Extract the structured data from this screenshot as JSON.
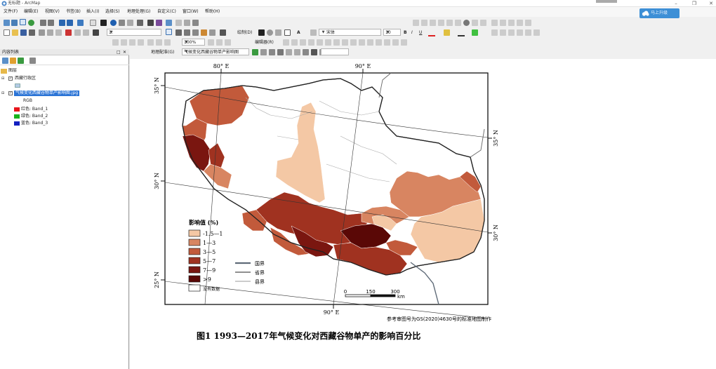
{
  "window": {
    "title": "无标题 - ArcMap"
  },
  "menu": [
    "文件(F)",
    "编辑(E)",
    "视图(V)",
    "书签(B)",
    "插入(I)",
    "选择(S)",
    "地理处理(G)",
    "自定义(C)",
    "窗口(W)",
    "帮助(H)"
  ],
  "cloud_button": "马上升级",
  "toolbar": {
    "scale_value": "1:",
    "zoom_value": "100%",
    "font_name": "宋体",
    "font_size": "10",
    "drawing_label": "绘制(D)",
    "editor_label": "编辑器(R)",
    "georef_label": "地理配准(G)",
    "georef_layer": "气候变化西藏谷物单产影响图"
  },
  "toc": {
    "title": "内容列表",
    "layers_label": "图层",
    "layer1": "西藏行政区",
    "layer2": "气候变化西藏谷物单产影响图.jpg",
    "rgb_label": "RGB",
    "bands": [
      {
        "label": "红色:   Band_1",
        "color": "#e8151b"
      },
      {
        "label": "绿色:   Band_2",
        "color": "#18b41c"
      },
      {
        "label": "蓝色:   Band_3",
        "color": "#1320c0"
      }
    ]
  },
  "map": {
    "lon_labels": [
      "80° E",
      "90° E",
      "90° E"
    ],
    "lat_left": [
      "35° N",
      "30° N",
      "25° N"
    ],
    "lat_right": [
      "35° N",
      "30° N"
    ],
    "legend_title": "影响值 (%)",
    "legend_items": [
      {
        "label": "-1.5—1",
        "color": "#f4c8a5"
      },
      {
        "label": "1—3",
        "color": "#d88561"
      },
      {
        "label": "3—5",
        "color": "#c25a3b"
      },
      {
        "label": "5—7",
        "color": "#a03220"
      },
      {
        "label": "7—9",
        "color": "#7a1610"
      },
      {
        "label": ">9",
        "color": "#5a0806"
      },
      {
        "label": "没有数据",
        "color": "#ffffff"
      }
    ],
    "line_legend": [
      {
        "label": "国界",
        "color": "#5f6b78"
      },
      {
        "label": "省界",
        "color": "#222222"
      },
      {
        "label": "县界",
        "color": "#9a9a9a"
      }
    ],
    "scale_labels": [
      "0",
      "150",
      "300"
    ],
    "scale_unit": "km",
    "note": "参考审图号为GS(2020)4630号的标准地图制作",
    "caption": "图1  1993—2017年气候变化对西藏谷物单产的影响百分比"
  }
}
